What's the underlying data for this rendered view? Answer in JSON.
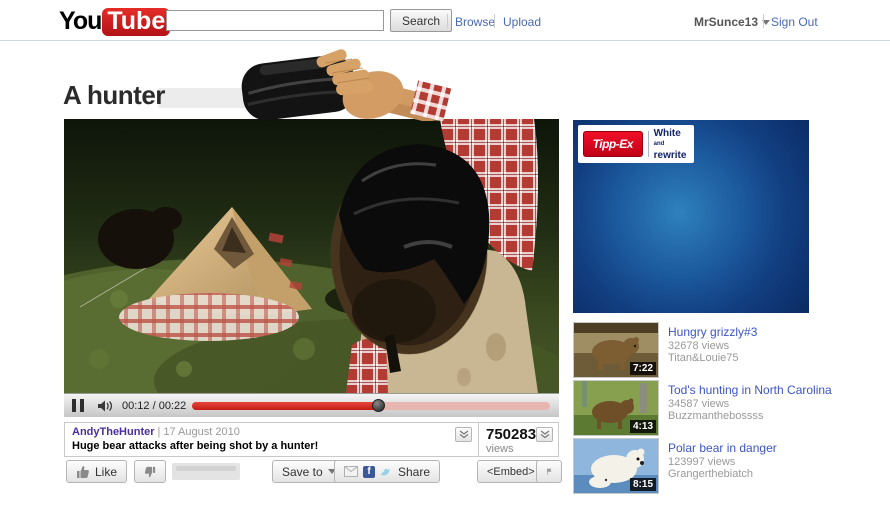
{
  "header": {
    "logo_you": "You",
    "logo_tube": "Tube",
    "search_value": "",
    "search_button": "Search",
    "nav_browse": "Browse",
    "nav_upload": "Upload",
    "username": "MrSunce13",
    "sign_out": "Sign Out"
  },
  "page": {
    "title": "A hunter"
  },
  "player": {
    "time": "00:12 / 00:22",
    "progress_percent": 52
  },
  "details": {
    "uploader": "AndyTheHunter",
    "separator": "|",
    "date": "17 August 2010",
    "description": "Huge bear attacks after being shot by a hunter!",
    "views_count": "750283",
    "views_label": "views"
  },
  "actions": {
    "like": "Like",
    "save_to": "Save to",
    "share": "Share",
    "embed": "<Embed>"
  },
  "ad": {
    "brand": "Tipp-Ex",
    "tagline_line1": "White",
    "tagline_line1_small": "and",
    "tagline_line2": "rewrite"
  },
  "related": {
    "items": [
      {
        "title": "Hungry grizzly#3",
        "views": "32678 views",
        "user": "Titan&Louie75",
        "duration": "7:22"
      },
      {
        "title": "Tod's hunting in North Carolina",
        "views": "34587 views",
        "user": "Buzzmanthebossss",
        "duration": "4:13"
      },
      {
        "title": "Polar bear in danger",
        "views": "123997 views",
        "user": "Grangerthebiatch",
        "duration": "8:15"
      }
    ]
  },
  "icons": {
    "facebook_letter": "f",
    "names": [
      "pause-icon",
      "volume-icon",
      "chevron-double-down-icon",
      "thumb-up-icon",
      "thumb-down-icon",
      "envelope-icon",
      "facebook-icon",
      "twitter-bird-icon",
      "flag-icon",
      "dropdown-caret-icon"
    ]
  },
  "colors": {
    "logo_red": "#cc181e",
    "link_blue": "#4a69b5",
    "related_link_blue": "#3c55c5",
    "uploader_purple": "#4b2d9f",
    "progress_red": "#d8261c",
    "ad_blue_light": "#2f81bd",
    "ad_blue_dark": "#0b2b62",
    "tippex_red": "#e2001a"
  }
}
